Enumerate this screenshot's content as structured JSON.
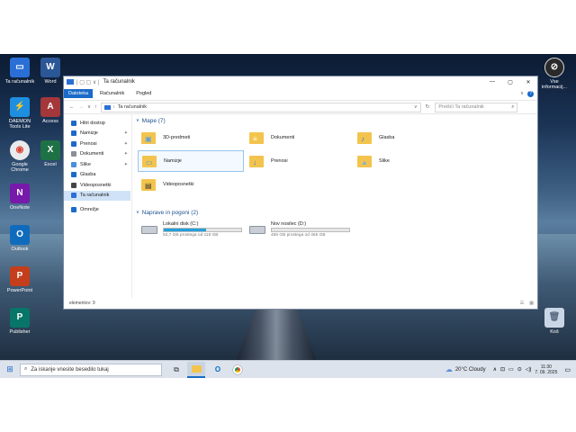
{
  "desktop": {
    "icons_left": [
      {
        "name": "desktop-icon-this-pc",
        "label": "Ta računalnik",
        "color": "#2a6fd6",
        "glyph": "▭"
      },
      {
        "name": "desktop-icon-word",
        "label": "Word",
        "color": "#2b5797",
        "glyph": "W"
      },
      {
        "name": "desktop-icon-daemon-tools",
        "label": "DAEMON Tools Lite",
        "color": "#1e8fe0",
        "glyph": "⚡"
      },
      {
        "name": "desktop-icon-access",
        "label": "Access",
        "color": "#a4373a",
        "glyph": "A"
      },
      {
        "name": "desktop-icon-chrome",
        "label": "Google Chrome",
        "color": "#e8eaed",
        "glyph": "◉"
      },
      {
        "name": "desktop-icon-excel",
        "label": "Excel",
        "color": "#1e7145",
        "glyph": "X"
      },
      {
        "name": "desktop-icon-onenote",
        "label": "OneNote",
        "color": "#7719aa",
        "glyph": "N"
      },
      {
        "name": "desktop-icon-outlook",
        "label": "Outlook",
        "color": "#0f6cbd",
        "glyph": "O"
      },
      {
        "name": "desktop-icon-powerpoint",
        "label": "PowerPoint",
        "color": "#c43e1c",
        "glyph": "P"
      },
      {
        "name": "desktop-icon-publisher",
        "label": "Publisher",
        "color": "#077568",
        "glyph": "P"
      }
    ],
    "right_icon_label": "Vse informacij...",
    "recycle_label": "Koš"
  },
  "window": {
    "title": "Ta računalnik",
    "tabs": [
      "Datoteka",
      "Računalnik",
      "Pogled"
    ],
    "address": "Ta računalnik",
    "search_placeholder": "Preišči Ta računalnik",
    "nav": [
      {
        "label": "Hitri dostop",
        "icon": "star-icon",
        "pin": false,
        "sel": false
      },
      {
        "label": "Namizje",
        "icon": "desktop-icon",
        "pin": true,
        "sel": false
      },
      {
        "label": "Prenosi",
        "icon": "download-icon",
        "pin": true,
        "sel": false
      },
      {
        "label": "Dokumenti",
        "icon": "document-icon",
        "pin": true,
        "sel": false
      },
      {
        "label": "Slike",
        "icon": "picture-icon",
        "pin": true,
        "sel": false
      },
      {
        "label": "Glasba",
        "icon": "music-icon",
        "pin": false,
        "sel": false
      },
      {
        "label": "Videoposnetki",
        "icon": "video-icon",
        "pin": false,
        "sel": false
      },
      {
        "label": "Ta računalnik",
        "icon": "pc-icon",
        "pin": false,
        "sel": true
      },
      {
        "label": "Omrežje",
        "icon": "network-icon",
        "pin": false,
        "sel": false
      }
    ],
    "folders_header": "Mape (7)",
    "folders": [
      {
        "label": "3D-predmeti",
        "icon": "3d-objects-icon"
      },
      {
        "label": "Dokumenti",
        "icon": "documents-folder-icon"
      },
      {
        "label": "Glasba",
        "icon": "music-folder-icon"
      },
      {
        "label": "Namizje",
        "icon": "desktop-folder-icon"
      },
      {
        "label": "Prenosi",
        "icon": "downloads-folder-icon"
      },
      {
        "label": "Slike",
        "icon": "pictures-folder-icon"
      },
      {
        "label": "Videoposnetki",
        "icon": "videos-folder-icon"
      }
    ],
    "drives_header": "Naprave in pogoni (2)",
    "drives": [
      {
        "label": "Lokalni disk (C:)",
        "free": "52,7 GB prostega od 118 GB",
        "used_fraction": 0.55
      },
      {
        "label": "Nov nosilec (D:)",
        "free": "465 GB prostega od 465 GB",
        "used_fraction": 0.0
      }
    ],
    "status": "elementov: 9"
  },
  "taskbar": {
    "search_placeholder": "Za iskanje vnesite besedilo tukaj",
    "weather": "20°C  Cloudy",
    "time": "11:30",
    "date": "7. 09. 2025"
  },
  "colors": {
    "accent": "#1b6ac9",
    "folder": "#f3c44d",
    "drive_bar": "#26a0da"
  }
}
